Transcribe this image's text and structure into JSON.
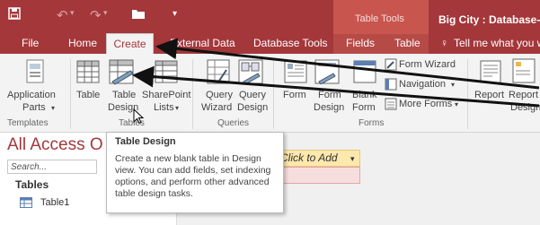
{
  "title_bar": {
    "tool_group": "Table Tools",
    "app_title": "Big City : Database- C:\\"
  },
  "tabs": {
    "file": "File",
    "home": "Home",
    "create": "Create",
    "external_data": "External Data",
    "database_tools": "Database Tools",
    "fields": "Fields",
    "table": "Table",
    "tell_me": "Tell me what you w"
  },
  "ribbon": {
    "templates": {
      "app_parts_l1": "Application",
      "app_parts_l2": "Parts",
      "group": "Templates"
    },
    "tables": {
      "table": "Table",
      "table_design_l1": "Table",
      "table_design_l2": "Design",
      "sharepoint_l1": "SharePoint",
      "sharepoint_l2": "Lists",
      "group": "Tables"
    },
    "queries": {
      "wizard_l1": "Query",
      "wizard_l2": "Wizard",
      "design_l1": "Query",
      "design_l2": "Design",
      "group": "Queries"
    },
    "forms": {
      "form": "Form",
      "form_design_l1": "Form",
      "form_design_l2": "Design",
      "blank_l1": "Blank",
      "blank_l2": "Form",
      "wizard": "Form Wizard",
      "navigation": "Navigation",
      "more": "More Forms",
      "group": "Forms"
    },
    "reports": {
      "report": "Report",
      "report_design_l1": "Report",
      "report_design_l2": "Design"
    }
  },
  "nav_pane": {
    "title": "All Access O",
    "search_placeholder": "Search...",
    "section": "Tables",
    "items": [
      "Table1"
    ]
  },
  "datasheet": {
    "click_to_add": "Click to Add"
  },
  "tooltip": {
    "title": "Table Design",
    "body": "Create a new blank table in Design view. You can add fields, set indexing options, and perform other advanced table design tasks."
  },
  "colors": {
    "accent": "#a4373a",
    "tool_tab": "#c9564e"
  }
}
